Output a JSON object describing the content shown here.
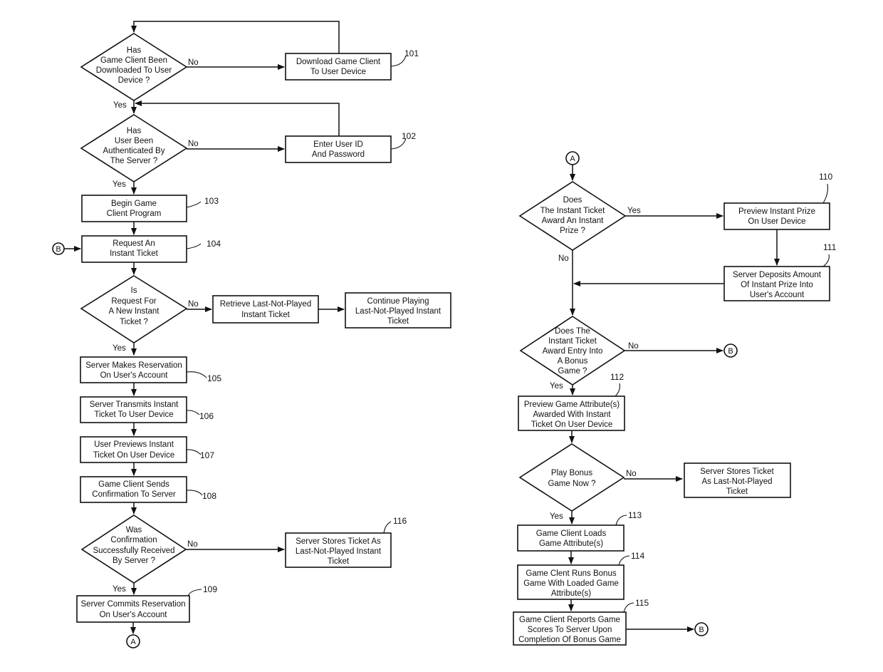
{
  "nodes": {
    "d_downloaded": {
      "type": "decision",
      "lines": [
        "Has",
        "Game Client Been",
        "Downloaded To User",
        "Device ?"
      ]
    },
    "n101": {
      "type": "process",
      "ref": "101",
      "lines": [
        "Download Game Client",
        "To User Device"
      ]
    },
    "d_authenticated": {
      "type": "decision",
      "lines": [
        "Has",
        "User Been",
        "Authenticated By",
        "The Server ?"
      ]
    },
    "n102": {
      "type": "process",
      "ref": "102",
      "lines": [
        "Enter User ID",
        "And Password"
      ]
    },
    "n103": {
      "type": "process",
      "ref": "103",
      "lines": [
        "Begin Game",
        "Client Program"
      ]
    },
    "n104": {
      "type": "process",
      "ref": "104",
      "lines": [
        "Request An",
        "Instant Ticket"
      ]
    },
    "d_new_ticket": {
      "type": "decision",
      "lines": [
        "Is",
        "Request For",
        "A New Instant",
        "Ticket ?"
      ]
    },
    "n_retrieve": {
      "type": "process",
      "lines": [
        "Retrieve Last-Not-Played",
        "Instant Ticket"
      ]
    },
    "n_continue": {
      "type": "process",
      "lines": [
        "Continue Playing",
        "Last-Not-Played Instant",
        "Ticket"
      ]
    },
    "n105": {
      "type": "process",
      "ref": "105",
      "lines": [
        "Server Makes Reservation",
        "On User's Account"
      ]
    },
    "n106": {
      "type": "process",
      "ref": "106",
      "lines": [
        "Server Transmits Instant",
        "Ticket To User Device"
      ]
    },
    "n107": {
      "type": "process",
      "ref": "107",
      "lines": [
        "User Previews Instant",
        "Ticket On User Device"
      ]
    },
    "n108": {
      "type": "process",
      "ref": "108",
      "lines": [
        "Game Client Sends",
        "Confirmation To Server"
      ]
    },
    "d_confirm": {
      "type": "decision",
      "lines": [
        "Was",
        "Confirmation",
        "Successfully Received",
        "By Server ?"
      ]
    },
    "n116": {
      "type": "process",
      "ref": "116",
      "lines": [
        "Server Stores Ticket As",
        "Last-Not-Played Instant",
        "Ticket"
      ]
    },
    "n109": {
      "type": "process",
      "ref": "109",
      "lines": [
        "Server Commits Reservation",
        "On User's Account"
      ]
    },
    "d_instant_prize": {
      "type": "decision",
      "lines": [
        "Does",
        "The Instant Ticket",
        "Award An Instant",
        "Prize ?"
      ]
    },
    "n110": {
      "type": "process",
      "ref": "110",
      "lines": [
        "Preview Instant Prize",
        "On User Device"
      ]
    },
    "n111": {
      "type": "process",
      "ref": "111",
      "lines": [
        "Server Deposits Amount",
        "Of Instant Prize Into",
        "User's Account"
      ]
    },
    "d_bonus_entry": {
      "type": "decision",
      "lines": [
        "Does The",
        "Instant Ticket",
        "Award Entry Into",
        "A Bonus",
        "Game ?"
      ]
    },
    "n112": {
      "type": "process",
      "ref": "112",
      "lines": [
        "Preview Game Attribute(s)",
        "Awarded With Instant",
        "Ticket On User Device"
      ]
    },
    "d_play_now": {
      "type": "decision",
      "lines": [
        "Play Bonus",
        "Game Now ?"
      ]
    },
    "n_store_lnp": {
      "type": "process",
      "lines": [
        "Server Stores Ticket",
        "As Last-Not-Played",
        "Ticket"
      ]
    },
    "n113": {
      "type": "process",
      "ref": "113",
      "lines": [
        "Game Client Loads",
        "Game Attribute(s)"
      ]
    },
    "n114": {
      "type": "process",
      "ref": "114",
      "lines": [
        "Game Clent Runs Bonus",
        "Game With Loaded Game",
        "Attribute(s)"
      ]
    },
    "n115": {
      "type": "process",
      "ref": "115",
      "lines": [
        "Game Client Reports Game",
        "Scores To Server Upon",
        "Completion Of Bonus Game"
      ]
    }
  },
  "connectors": {
    "A": "A",
    "B": "B"
  },
  "edge_labels": {
    "yes": "Yes",
    "no": "No"
  }
}
